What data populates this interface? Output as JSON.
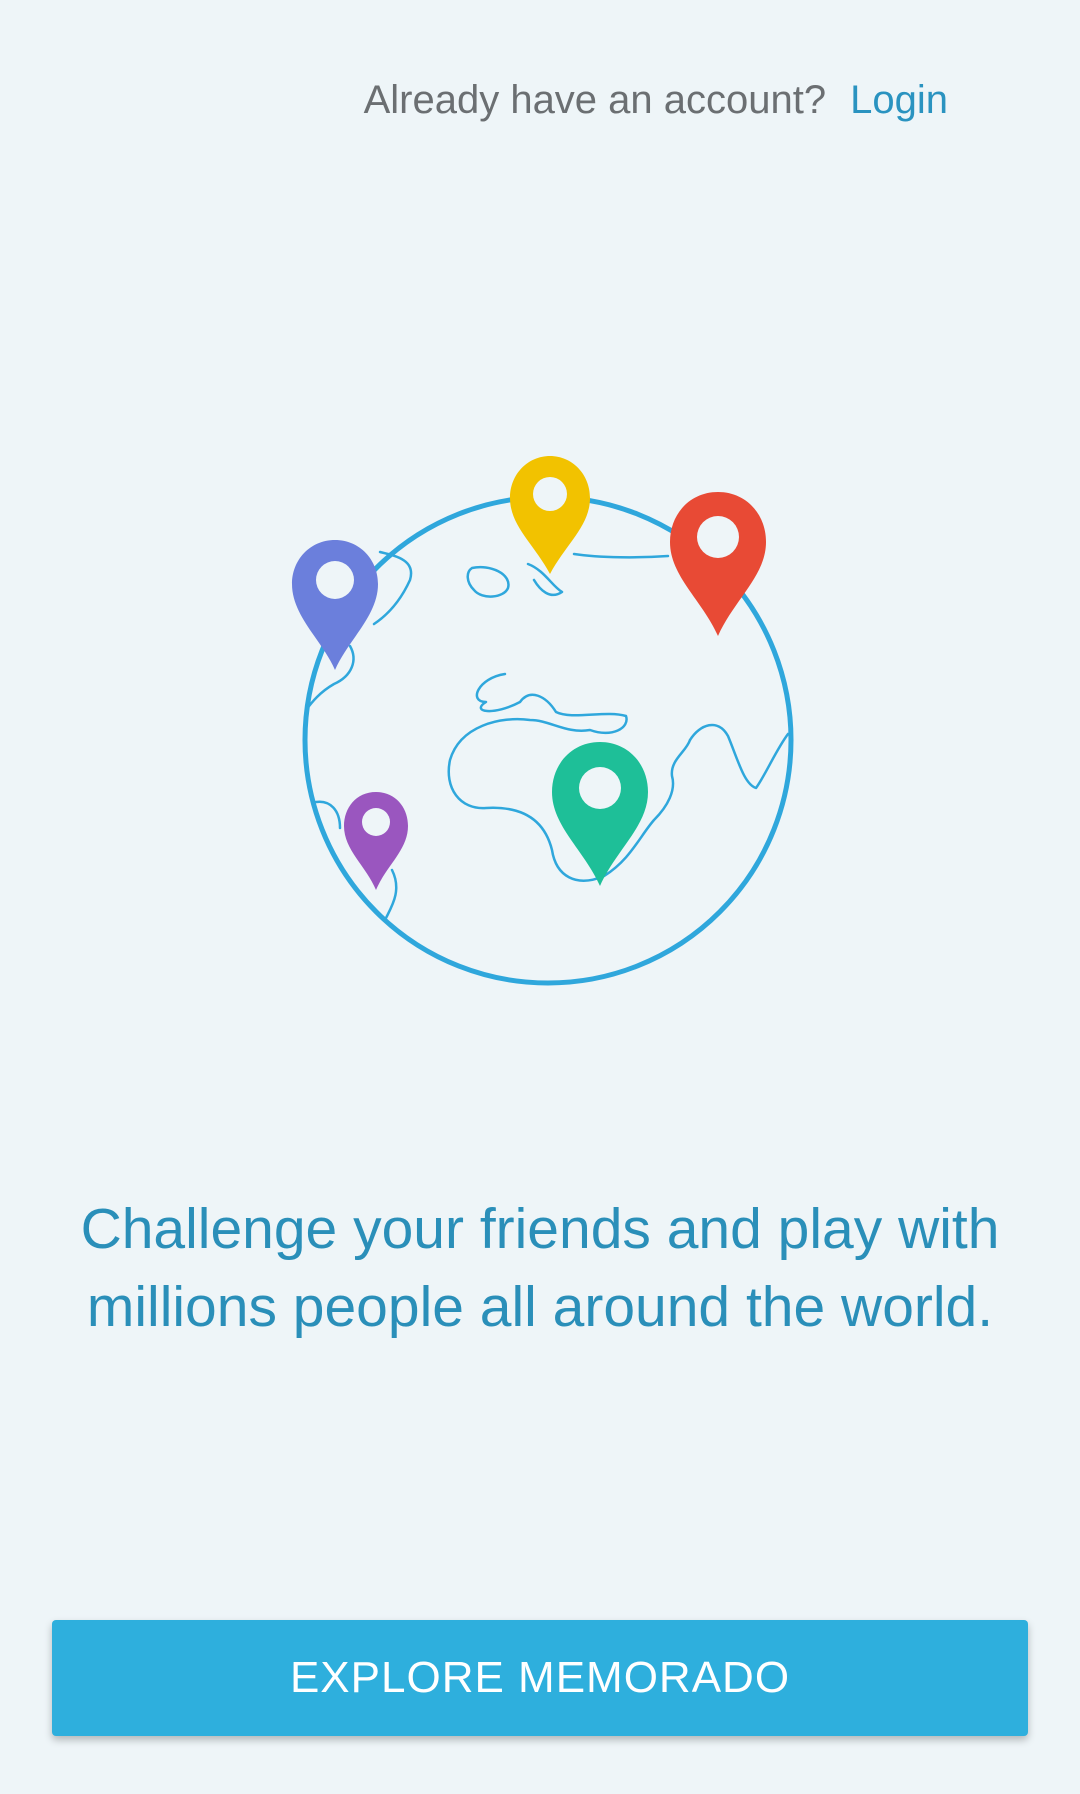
{
  "header": {
    "prompt_text": "Already have an account?",
    "login_label": "Login"
  },
  "illustration": {
    "icon": "globe-with-map-pins",
    "colors": {
      "globe_outline": "#2fa7dc",
      "pin_blue": "#6b7fdc",
      "pin_yellow": "#f2c200",
      "pin_red": "#e84a35",
      "pin_green": "#1ebf98",
      "pin_purple": "#9a56bf"
    }
  },
  "main": {
    "tagline": "Challenge your friends and play with millions people all around the world."
  },
  "footer": {
    "cta_label": "EXPLORE MEMORADO"
  },
  "theme": {
    "background": "#eef5f8",
    "accent": "#2eafdd",
    "link": "#2a93c0",
    "tagline_color": "#2a8fb9"
  }
}
